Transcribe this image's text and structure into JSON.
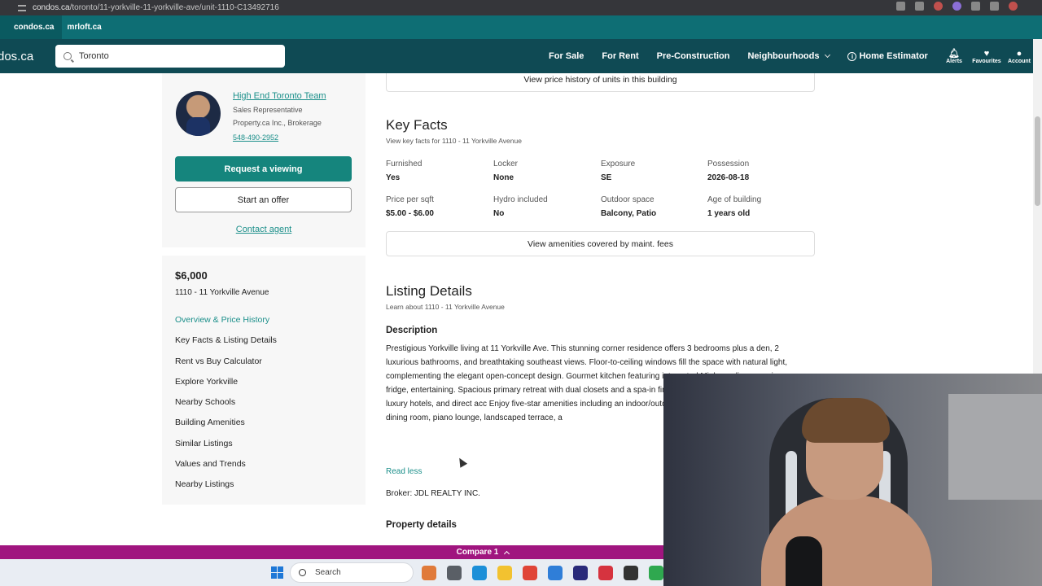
{
  "browser": {
    "url_host": "condos.ca",
    "url_path": "/toronto/11-yorkville-11-yorkville-ave/unit-1110-C13492716",
    "tabs": [
      {
        "label": "condos.ca"
      },
      {
        "label": "mrloft.ca"
      }
    ]
  },
  "nav": {
    "logo": "dos.ca",
    "search_value": "Toronto",
    "links": [
      "For Sale",
      "For Rent",
      "Pre-Construction",
      "Neighbourhoods",
      "Home Estimator"
    ],
    "icons": [
      {
        "label": "Alerts",
        "icon": "bell-icon"
      },
      {
        "label": "Favourites",
        "icon": "heart-icon"
      },
      {
        "label": "Account",
        "icon": "account-icon"
      }
    ]
  },
  "agent": {
    "name": "High End Toronto Team",
    "role": "Sales Representative",
    "brokerage": "Property.ca Inc., Brokerage",
    "phone": "548-490-2952",
    "request_viewing": "Request a viewing",
    "start_offer": "Start an offer",
    "contact": "Contact agent"
  },
  "sidebar": {
    "price": "$6,000",
    "address": "1110 - 11 Yorkville Avenue",
    "items": [
      {
        "label": "Overview & Price History",
        "active": true
      },
      {
        "label": "Key Facts & Listing Details"
      },
      {
        "label": "Rent vs Buy Calculator"
      },
      {
        "label": "Explore Yorkville"
      },
      {
        "label": "Nearby Schools"
      },
      {
        "label": "Building Amenities"
      },
      {
        "label": "Similar Listings"
      },
      {
        "label": "Values and Trends"
      },
      {
        "label": "Nearby Listings"
      }
    ]
  },
  "main": {
    "price_history_button": "View price history of units in this building",
    "key_facts": {
      "title": "Key Facts",
      "subtitle": "View key facts for 1110 - 11 Yorkville Avenue",
      "facts": [
        {
          "label": "Furnished",
          "value": "Yes"
        },
        {
          "label": "Locker",
          "value": "None"
        },
        {
          "label": "Exposure",
          "value": "SE"
        },
        {
          "label": "Possession",
          "value": "2026-08-18"
        },
        {
          "label": "Price per sqft",
          "value": "$5.00 - $6.00"
        },
        {
          "label": "Hydro included",
          "value": "No"
        },
        {
          "label": "Outdoor space",
          "value": "Balcony,  Patio"
        },
        {
          "label": "Age of building",
          "value": "1 years old"
        }
      ],
      "amenities_button": "View amenities covered by maint. fees"
    },
    "listing_details": {
      "title": "Listing Details",
      "subtitle": "Learn about 1110 - 11 Yorkville Avenue",
      "description_heading": "Description",
      "description": "Prestigious Yorkville living at 11 Yorkville Ave. This stunning corner residence offers 3 bedrooms plus a den, 2 luxurious bathrooms, and breathtaking southeast views. Floor-to-ceiling windows fill the space with natural light, complementing the elegant open-concept design. Gourmet kitchen featuring integrated Miele appliances, wine fridge, entertaining. Spacious primary retreat with dual closets and a spa-in finest boutiques, acclaimed restaurants, luxury hotels, and direct acc Enjoy five-star amenities including an indoor/outdoor infinity pool, s wellness spa, wine dining room, piano lounge, landscaped terrace, a",
      "read_less": "Read less",
      "broker": "Broker: JDL REALTY INC.",
      "property_details_heading": "Property details"
    }
  },
  "compare_bar": {
    "label": "Compare 1"
  },
  "taskbar": {
    "search_placeholder": "Search",
    "apps": [
      {
        "icon": "copilot-icon",
        "color": "#e07a3a"
      },
      {
        "icon": "task-view-icon",
        "color": "#5a5f66"
      },
      {
        "icon": "edge-icon",
        "color": "#1c8fd8"
      },
      {
        "icon": "file-explorer-icon",
        "color": "#f2c230"
      },
      {
        "icon": "chrome-icon",
        "color": "#e04437"
      },
      {
        "icon": "store-icon",
        "color": "#2f7ed8"
      },
      {
        "icon": "premiere-icon",
        "color": "#2a2a7a"
      },
      {
        "icon": "app-red-icon",
        "color": "#d6333f"
      },
      {
        "icon": "obs-icon",
        "color": "#333333"
      },
      {
        "icon": "drive-icon",
        "color": "#2fa84f"
      },
      {
        "icon": "chrome-alt-icon",
        "color": "#e04437"
      }
    ]
  },
  "colors": {
    "teal_accent": "#15857d",
    "nav_bg": "#0f4a54",
    "compare_bar": "#a0157f"
  }
}
